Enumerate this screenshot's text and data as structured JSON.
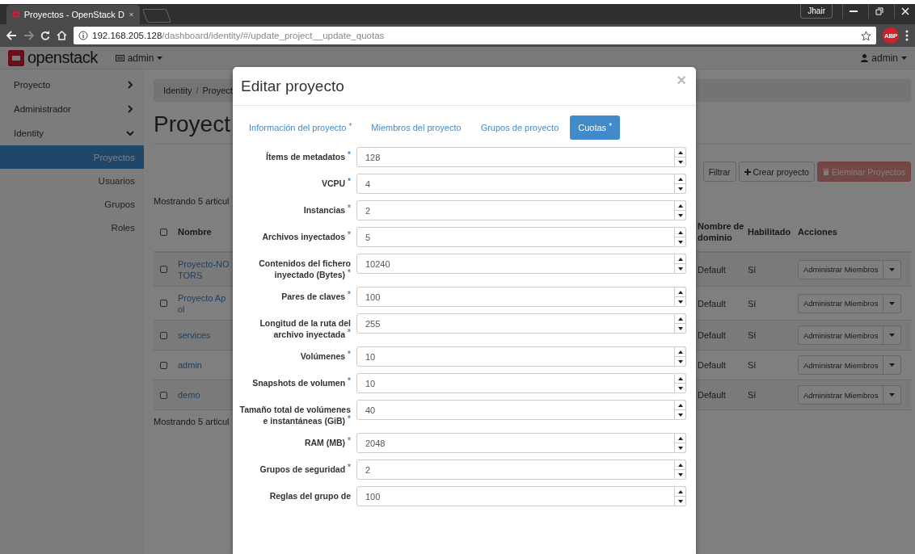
{
  "browser": {
    "tab_title": "Proyectos - OpenStack D",
    "profile": "Jhair",
    "url_host": "192.168.205.128",
    "url_path": "/dashboard/identity/#/update_project__update_quotas",
    "extension_badge": "ABP"
  },
  "header": {
    "logo_text": "openstack",
    "project": "admin",
    "user": "admin"
  },
  "sidebar": {
    "sections": [
      {
        "label": "Proyecto",
        "expanded": false
      },
      {
        "label": "Administrador",
        "expanded": false
      },
      {
        "label": "Identity",
        "expanded": true,
        "children": [
          {
            "label": "Proyectos",
            "selected": true
          },
          {
            "label": "Usuarios",
            "selected": false
          },
          {
            "label": "Grupos",
            "selected": false
          },
          {
            "label": "Roles",
            "selected": false
          }
        ]
      }
    ]
  },
  "page": {
    "breadcrumb": {
      "items": [
        "Identity",
        "Proyect"
      ],
      "separator": "/"
    },
    "title": "Proyect",
    "toolbar": [
      {
        "kind": "default",
        "label": "Filtrar",
        "disabled": false
      },
      {
        "kind": "create",
        "label": "Crear proyecto",
        "disabled": false
      },
      {
        "kind": "delete",
        "label": "Eleminar Proyectos",
        "disabled": true
      }
    ],
    "count_top": "Mostrando 5 articul",
    "count_bottom": "Mostrando 5 articul",
    "table": {
      "columns": [
        "Nombre",
        "Nombre de dominio",
        "Habilitado",
        "Acciones"
      ],
      "header_checked": false,
      "rows": [
        {
          "checked": false,
          "name_lines": [
            "Proyecto-NO",
            "TORS"
          ],
          "domain": "Default",
          "enabled": "Sí",
          "action": "Administrar Miembros"
        },
        {
          "checked": false,
          "name_lines": [
            "Proyecto Ap",
            "ol"
          ],
          "domain": "Default",
          "enabled": "Sí",
          "action": "Administrar Miembros"
        },
        {
          "checked": false,
          "name_lines": [
            "services"
          ],
          "domain": "Default",
          "enabled": "Sí",
          "action": "Administrar Miembros"
        },
        {
          "checked": false,
          "name_lines": [
            "admin"
          ],
          "domain": "Default",
          "enabled": "Sí",
          "action": "Administrar Miembros"
        },
        {
          "checked": false,
          "name_lines": [
            "demo"
          ],
          "domain": "Default",
          "enabled": "Sí",
          "action": "Administrar Miembros"
        }
      ]
    }
  },
  "modal": {
    "title": "Editar proyecto",
    "close": "×",
    "required_mark": "*",
    "tabs": [
      {
        "label": "Información del proyecto",
        "required": true,
        "selected": false
      },
      {
        "label": "Miembros del proyecto",
        "required": false,
        "selected": false
      },
      {
        "label": "Grupos de proyecto",
        "required": false,
        "selected": false
      },
      {
        "label": "Cuotas",
        "required": true,
        "selected": true
      }
    ],
    "fields": [
      {
        "label": "Ítems de metadatos",
        "required": true,
        "value": "128"
      },
      {
        "label": "VCPU",
        "required": true,
        "value": "4"
      },
      {
        "label": "Instancias",
        "required": true,
        "value": "2"
      },
      {
        "label": "Archivos inyectados",
        "required": true,
        "value": "5"
      },
      {
        "label": "Contenidos del fichero inyectado (Bytes)",
        "required": true,
        "value": "10240"
      },
      {
        "label": "Pares de claves",
        "required": true,
        "value": "100"
      },
      {
        "label": "Longitud de la ruta del archivo inyectada",
        "required": true,
        "value": "255"
      },
      {
        "label": "Volúmenes",
        "required": true,
        "value": "10"
      },
      {
        "label": "Snapshots de volumen",
        "required": true,
        "value": "10"
      },
      {
        "label": "Tamaño total de volúmenes e instantáneas (GiB)",
        "required": true,
        "value": "40"
      },
      {
        "label": "RAM (MB)",
        "required": true,
        "value": "2048"
      },
      {
        "label": "Grupos de seguridad",
        "required": true,
        "value": "2"
      },
      {
        "label": "Reglas del grupo de",
        "required": false,
        "value": "100"
      }
    ]
  }
}
